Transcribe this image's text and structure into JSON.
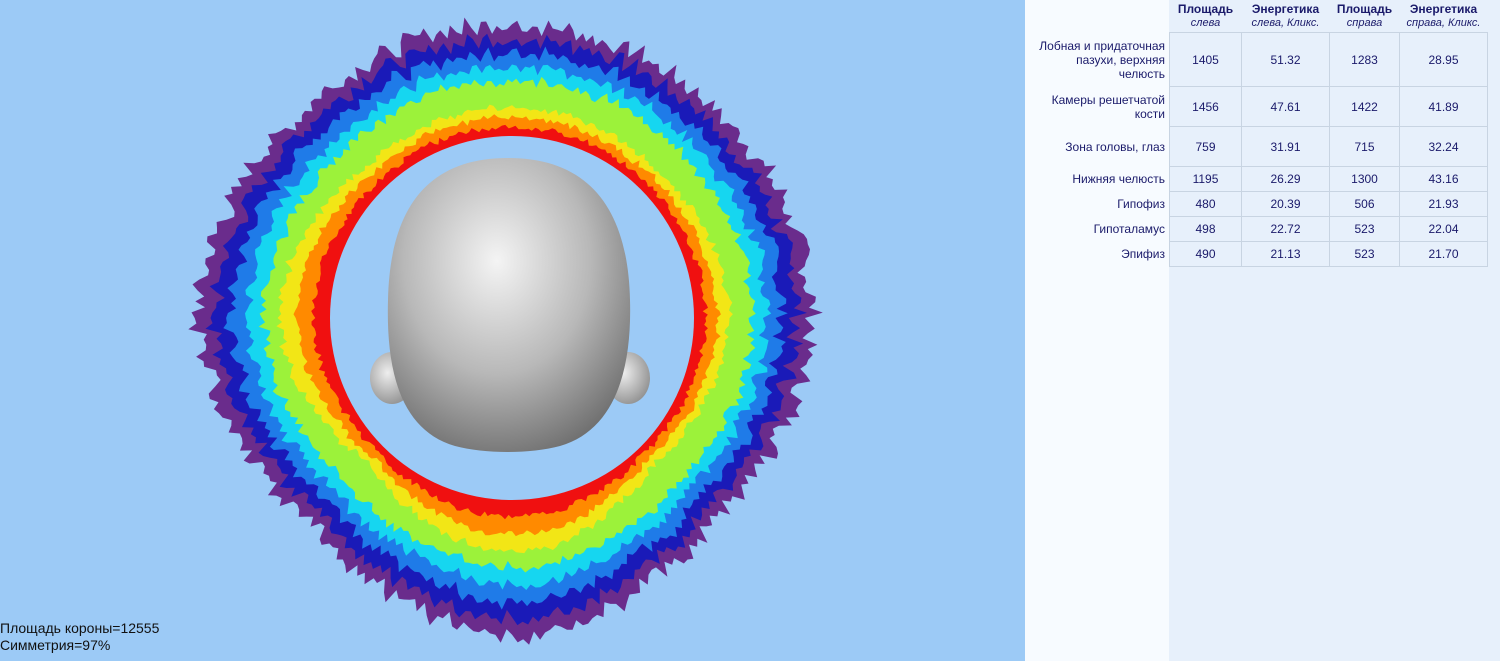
{
  "stats": {
    "crown_area": "Площадь короны=12555",
    "symmetry": "Симметрия=97%"
  },
  "table": {
    "headers": [
      {
        "title": "Площадь",
        "sub": "слева"
      },
      {
        "title": "Энергетика",
        "sub": "слева, Кликс."
      },
      {
        "title": "Площадь",
        "sub": "справа"
      },
      {
        "title": "Энергетика",
        "sub": "справа, Кликс."
      }
    ],
    "rows": [
      {
        "label": "Лобная и придаточная пазухи, верхняя челюсть",
        "values": [
          "1405",
          "51.32",
          "1283",
          "28.95"
        ]
      },
      {
        "label": "Камеры решетчатой кости",
        "values": [
          "1456",
          "47.61",
          "1422",
          "41.89"
        ]
      },
      {
        "label": "Зона головы, глаз",
        "values": [
          "759",
          "31.91",
          "715",
          "32.24"
        ]
      },
      {
        "label": "Нижняя челюсть",
        "values": [
          "1195",
          "26.29",
          "1300",
          "43.16"
        ]
      },
      {
        "label": "Гипофиз",
        "values": [
          "480",
          "20.39",
          "506",
          "21.93"
        ]
      },
      {
        "label": "Гипоталамус",
        "values": [
          "498",
          "22.72",
          "523",
          "22.04"
        ]
      },
      {
        "label": "Эпифиз",
        "values": [
          "490",
          "21.13",
          "523",
          "21.70"
        ]
      }
    ]
  },
  "colors": {
    "background": "#9ccaf6",
    "panel": "#e7f0fb",
    "text": "#1a1a6a",
    "heat_scale": [
      "#6a2c8c",
      "#1a1ab8",
      "#1f7be8",
      "#16d6f0",
      "#9cf23a",
      "#f2e616",
      "#ff8a00",
      "#f01010"
    ]
  },
  "aura": {
    "sectors": [
      {
        "name": "top",
        "energy": 0.55
      },
      {
        "name": "upper-right",
        "energy": 0.5
      },
      {
        "name": "right",
        "energy": 0.65
      },
      {
        "name": "right-lower",
        "energy": 0.45
      },
      {
        "name": "bottom",
        "energy": 0.95
      },
      {
        "name": "left-lower",
        "energy": 0.45
      },
      {
        "name": "left",
        "energy": 0.9
      },
      {
        "name": "upper-left",
        "energy": 0.55
      }
    ]
  }
}
